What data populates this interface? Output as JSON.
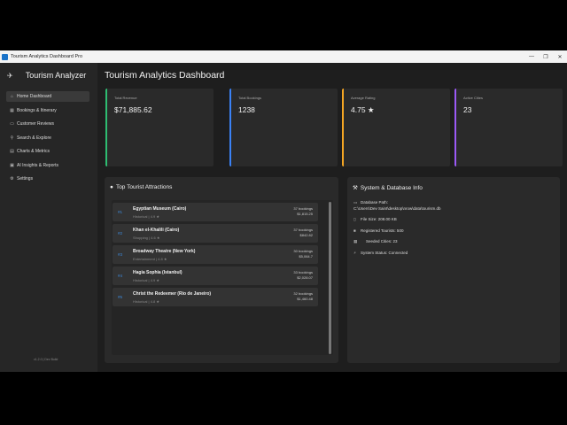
{
  "window": {
    "title": "Tourism Analytics Dashboard Pro",
    "minimize": "—",
    "maximize": "❐",
    "close": "✕"
  },
  "sidebar": {
    "brand": "Tourism Analyzer",
    "items": [
      {
        "label": "Home Dashboard",
        "icon": "home-icon"
      },
      {
        "label": "Bookings & Itinerary",
        "icon": "calendar-icon"
      },
      {
        "label": "Customer Reviews",
        "icon": "chat-icon"
      },
      {
        "label": "Search & Explore",
        "icon": "search-icon"
      },
      {
        "label": "Charts & Metrics",
        "icon": "chart-icon"
      },
      {
        "label": "AI Insights & Reports",
        "icon": "ai-icon"
      },
      {
        "label": "Settings",
        "icon": "gear-icon"
      }
    ],
    "version": "v1.2.0 | Dev Build"
  },
  "main": {
    "title": "Tourism Analytics Dashboard",
    "kpis": [
      {
        "label": "Total Revenue",
        "value": "$71,885.62",
        "color": "#2ebd72"
      },
      {
        "label": "Total Bookings",
        "value": "1238",
        "color": "#3b82f6"
      },
      {
        "label": "Average Rating",
        "value": "4.75 ★",
        "color": "#f5a623"
      },
      {
        "label": "Active Cities",
        "value": "23",
        "color": "#9b59f6"
      }
    ],
    "attractions_panel": {
      "title": "Top Tourist Attractions",
      "rows": [
        {
          "rank": "#1",
          "name": "Egyptian Museum (Cairo)",
          "category": "Historical | 4.9 ★",
          "bookings": "37 bookings",
          "revenue": "$1,815.25"
        },
        {
          "rank": "#2",
          "name": "Khan el-Khalili (Cairo)",
          "category": "Shopping | 4.6 ★",
          "bookings": "37 bookings",
          "revenue": "$842.82"
        },
        {
          "rank": "#3",
          "name": "Broadway Theatre (New York)",
          "category": "Entertainment | 4.8 ★",
          "bookings": "30 bookings",
          "revenue": "$5,064.7"
        },
        {
          "rank": "#4",
          "name": "Hagia Sophia (Istanbul)",
          "category": "Historical | 4.9 ★",
          "bookings": "33 bookings",
          "revenue": "$2,028.07"
        },
        {
          "rank": "#5",
          "name": "Christ the Redeemer (Rio de Janeiro)",
          "category": "Historical | 4.8 ★",
          "bookings": "32 bookings",
          "revenue": "$1,460.48"
        }
      ]
    },
    "system_panel": {
      "title": "System & Database Info",
      "db_path_label": "Database Path:",
      "db_path": "C:\\Users\\Dev Saint\\desktop\\nrow\\data\\tourism.db",
      "file_size": "File Size: 208.00 KB",
      "tourists": "Registered Tourists: 500",
      "cities": "Seeded Cities: 23",
      "status": "System Status: Connected"
    }
  }
}
